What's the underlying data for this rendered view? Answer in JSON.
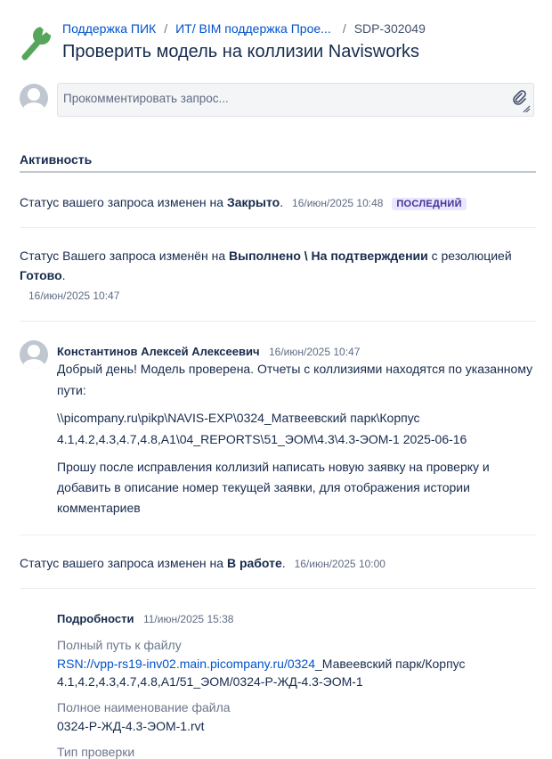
{
  "breadcrumb": {
    "project": "Поддержка ПИК",
    "queue": "ИТ/ BIM поддержка Прое...",
    "issue_key": "SDP-302049"
  },
  "issue": {
    "title": "Проверить модель на коллизии Navisworks"
  },
  "comment_box": {
    "placeholder": "Прокомментировать запрос..."
  },
  "activity": {
    "heading": "Активность",
    "status1": {
      "prefix": "Статус вашего запроса изменен на ",
      "status": "Закрыто",
      "suffix": ".",
      "timestamp": "16/июн/2025 10:48",
      "badge": "ПОСЛЕДНИЙ"
    },
    "status2": {
      "prefix": "Статус Вашего запроса изменён на ",
      "status": "Выполнено \\ На подтверждении",
      "middle": " с резолюцией",
      "resolution": "Готово",
      "suffix": ".",
      "timestamp": "16/июн/2025 10:47"
    },
    "comment": {
      "author": "Константинов Алексей Алексеевич",
      "timestamp": "16/июн/2025 10:47",
      "p1_line1": "Добрый день! Модель проверена. Отчеты с коллизиями находятся по указанному",
      "p1_line2": "пути:",
      "p2_line1": "\\\\picompany.ru\\pikp\\NAVIS-EXP\\0324_Матвеевский парк\\Корпус",
      "p2_line2": "4.1,4.2,4.3,4.7,4.8,А1\\04_REPORTS\\51_ЭОМ\\4.3\\4.3-ЭОМ-1 2025-06-16",
      "p3_line1": "Прошу после исправления коллизий написать новую заявку на проверку и",
      "p3_line2": "добавить в описание номер текущей заявки, для отображения истории",
      "p3_line3": "комментариев"
    },
    "status3": {
      "prefix": "Статус вашего запроса изменен на ",
      "status": "В работе",
      "suffix": ".",
      "timestamp": "16/июн/2025 10:00"
    },
    "details": {
      "heading": "Подробности",
      "timestamp": "11/июн/2025 15:38",
      "path_label": "Полный путь к файлу",
      "path_link": "RSN://vpp-rs19-inv02.main.picompany.ru/0324",
      "path_rest": "_Мавеевский парк/Корпус",
      "path_line2": "4.1,4.2,4.3,4.7,4.8,А1/51_ЭОМ/0324-Р-ЖД-4.3-ЭОМ-1",
      "name_label": "Полное наименование файла",
      "name_value": "0324-Р-ЖД-4.3-ЭОМ-1.rvt",
      "type_label": "Тип проверки"
    }
  },
  "colors": {
    "accent": "#0052cc",
    "icon_green": "#57a55a",
    "badge_bg": "#eae6ff",
    "badge_fg": "#403294"
  },
  "icons": {
    "project": "wrench-icon",
    "avatar": "default-avatar",
    "attach": "paperclip-icon"
  }
}
